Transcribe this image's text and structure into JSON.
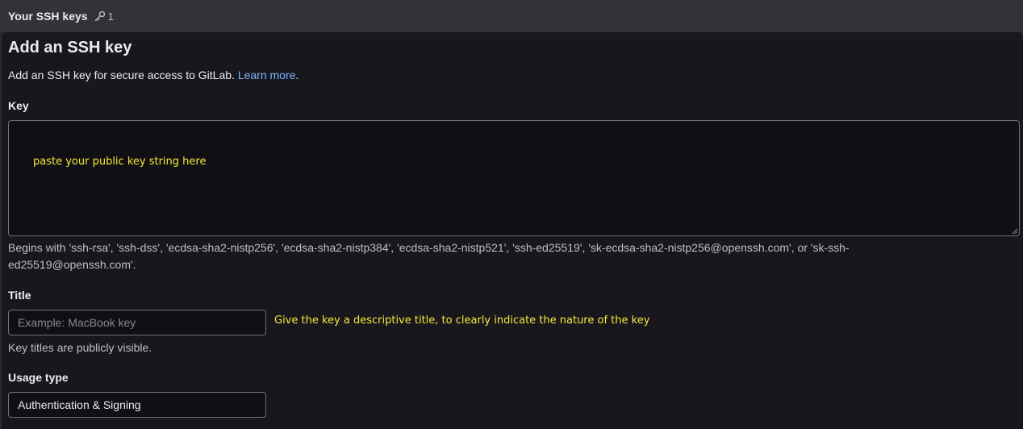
{
  "header": {
    "title": "Your SSH keys",
    "key_count": "1",
    "key_icon": "key-icon"
  },
  "form": {
    "title": "Add an SSH key",
    "intro_text": "Add an SSH key for secure access to GitLab. ",
    "learn_more": "Learn more",
    "intro_end": ".",
    "key": {
      "label": "Key",
      "annotation": "paste your public key string here",
      "help": "Begins with 'ssh-rsa', 'ssh-dss', 'ecdsa-sha2-nistp256', 'ecdsa-sha2-nistp384', 'ecdsa-sha2-nistp521', 'ssh-ed25519', 'sk-ecdsa-sha2-nistp256@openssh.com', or 'sk-ssh-ed25519@openssh.com'."
    },
    "title_field": {
      "label": "Title",
      "placeholder": "Example: MacBook key",
      "value": "",
      "annotation": "Give the key a descriptive title, to clearly indicate the nature of the key",
      "help": "Key titles are publicly visible."
    },
    "usage_type": {
      "label": "Usage type",
      "value": "Authentication & Signing"
    }
  },
  "colors": {
    "background": "#18171d",
    "header": "#333238",
    "link": "#7fb6ff",
    "annotation": "#f5e93a",
    "border": "#737278"
  }
}
